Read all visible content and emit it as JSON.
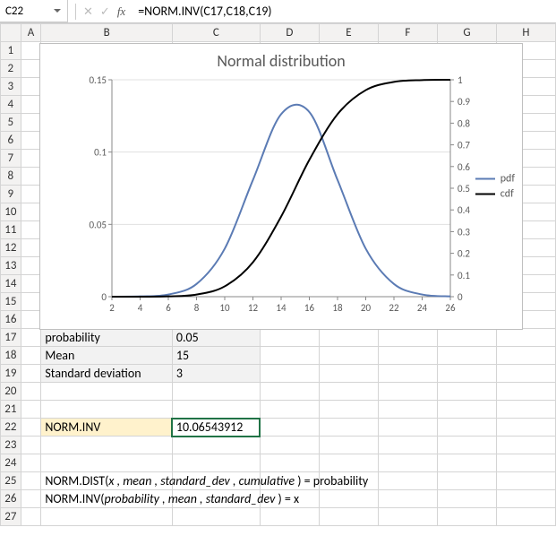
{
  "name_box": "C22",
  "formula": "=NORM.INV(C17,C18,C19)",
  "col_headers": [
    "A",
    "B",
    "C",
    "D",
    "E",
    "F",
    "G",
    "H"
  ],
  "row_headers": [
    "1",
    "2",
    "3",
    "4",
    "5",
    "6",
    "7",
    "8",
    "9",
    "10",
    "11",
    "12",
    "13",
    "14",
    "15",
    "16",
    "17",
    "18",
    "19",
    "20",
    "21",
    "22",
    "23",
    "24",
    "25",
    "26",
    "27"
  ],
  "cells": {
    "B17": "probability",
    "C17": "0.05",
    "B18": "Mean",
    "C18": "15",
    "B19": "Standard deviation",
    "C19": "3",
    "B22": "NORM.INV",
    "C22": "10.06543912"
  },
  "note25_pre": "NORM.DIST(",
  "note25_args": "x , mean , standard_dev , cumulative ",
  "note25_post": ") = probability",
  "note26_pre": "NORM.INV(",
  "note26_args": "probability , mean , standard_dev ",
  "note26_post": ") = x",
  "chart_data": {
    "type": "line",
    "title": "Normal distribution",
    "xlabel": "",
    "ylabel": "",
    "x": [
      2,
      4,
      6,
      8,
      10,
      12,
      14,
      16,
      18,
      20,
      22,
      24,
      26
    ],
    "xlim": [
      2,
      26
    ],
    "y1_ticks": [
      0,
      0.05,
      0.1,
      0.15
    ],
    "y1_lim": [
      0,
      0.15
    ],
    "y2_ticks": [
      0,
      0.1,
      0.2,
      0.3,
      0.4,
      0.5,
      0.6,
      0.7,
      0.8,
      0.9,
      1
    ],
    "y2_lim": [
      0,
      1
    ],
    "series": [
      {
        "name": "pdf",
        "axis": "y1",
        "color": "#5b7bb4",
        "values": [
          0.0,
          0.0002,
          0.0015,
          0.0088,
          0.0332,
          0.0807,
          0.1262,
          0.1277,
          0.0807,
          0.0332,
          0.0088,
          0.0015,
          0.0002
        ]
      },
      {
        "name": "cdf",
        "axis": "y2",
        "color": "#000000",
        "values": [
          0.0,
          0.0001,
          0.0013,
          0.0098,
          0.0478,
          0.1587,
          0.3694,
          0.6306,
          0.8413,
          0.9522,
          0.9902,
          0.9987,
          0.9999
        ]
      }
    ],
    "legend_position": "right"
  }
}
